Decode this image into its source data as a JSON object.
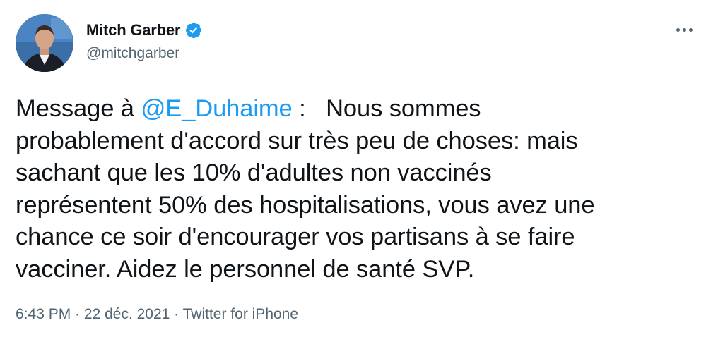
{
  "author": {
    "display_name": "Mitch Garber",
    "handle": "@mitchgarber",
    "verified_icon": "verified-badge-icon",
    "verified_color": "#1d9bf0"
  },
  "tweet": {
    "line1_before": "Message à ",
    "mention": "@E_Duhaime",
    "line1_after": " :   Nous sommes",
    "line2": "probablement d'accord sur très peu de choses: mais",
    "line3": "sachant que les 10% d'adultes non vaccinés",
    "line4": "représentent 50% des hospitalisations, vous avez une",
    "line5": "chance ce soir d'encourager vos partisans à se faire",
    "line6": "vacciner. Aidez le personnel de santé SVP."
  },
  "meta": {
    "time": "6:43 PM",
    "separator1": " · ",
    "date": "22 déc. 2021",
    "separator2": " · ",
    "source": "Twitter for iPhone"
  },
  "colors": {
    "text": "#0f1419",
    "secondary": "#536471",
    "link": "#1d9bf0",
    "divider": "#eff3f4"
  },
  "icons": {
    "more": "more-options-icon"
  }
}
